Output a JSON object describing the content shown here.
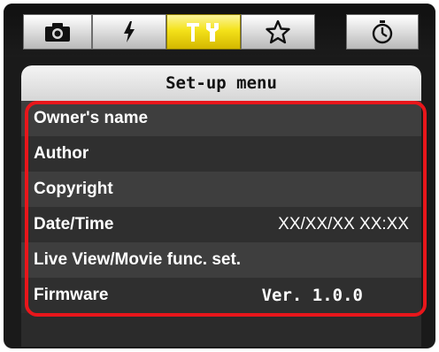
{
  "tabs": [
    {
      "icon": "camera-icon",
      "active": false
    },
    {
      "icon": "flash-icon",
      "active": false
    },
    {
      "icon": "wrench-icon",
      "active": true
    },
    {
      "icon": "star-icon",
      "active": false
    },
    {
      "icon": "timer-icon",
      "active": false
    }
  ],
  "menu": {
    "title": "Set-up menu",
    "items": [
      {
        "label": "Owner's name",
        "value": ""
      },
      {
        "label": "Author",
        "value": ""
      },
      {
        "label": "Copyright",
        "value": ""
      },
      {
        "label": "Date/Time",
        "value": "XX/XX/XX XX:XX"
      },
      {
        "label": "Live View/Movie func. set.",
        "value": ""
      },
      {
        "label": "Firmware",
        "value": "Ver. 1.0.0"
      }
    ]
  },
  "colors": {
    "active_tab": "#f4e21a",
    "highlight_border": "#e8161b",
    "panel_bg": "#303030"
  }
}
